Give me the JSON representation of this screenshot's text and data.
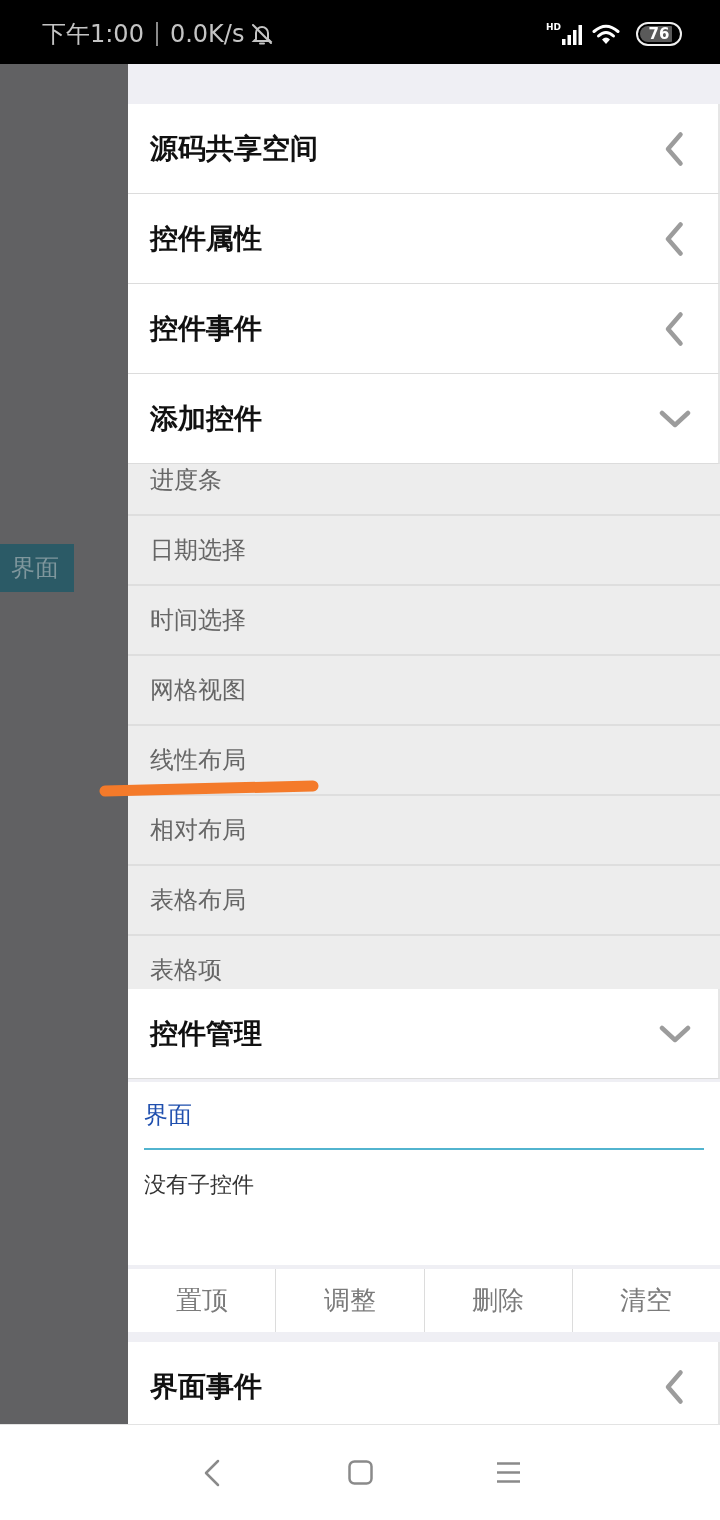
{
  "status_bar": {
    "time": "下午1:00",
    "network_speed": "0.0K/s",
    "network_type": "HD",
    "battery": "76"
  },
  "canvas": {
    "view_label": "界面"
  },
  "sections": [
    {
      "title": "源码共享空间",
      "expanded": false
    },
    {
      "title": "控件属性",
      "expanded": false
    },
    {
      "title": "控件事件",
      "expanded": false
    },
    {
      "title": "添加控件",
      "expanded": true,
      "body": {
        "kind": "list",
        "items": [
          {
            "label": "进度条",
            "underlined": false
          },
          {
            "label": "日期选择",
            "underlined": false
          },
          {
            "label": "时间选择",
            "underlined": false
          },
          {
            "label": "网格视图",
            "underlined": false
          },
          {
            "label": "线性布局",
            "underlined": true
          },
          {
            "label": "相对布局",
            "underlined": false
          },
          {
            "label": "表格布局",
            "underlined": false
          },
          {
            "label": "表格项",
            "underlined": false
          }
        ]
      }
    },
    {
      "title": "控件管理",
      "expanded": true,
      "body": {
        "kind": "manager",
        "path_label": "界面",
        "empty_text": "没有子控件",
        "buttons": [
          "置顶",
          "调整",
          "删除",
          "清空"
        ]
      }
    },
    {
      "title": "界面事件",
      "expanded": false
    }
  ]
}
